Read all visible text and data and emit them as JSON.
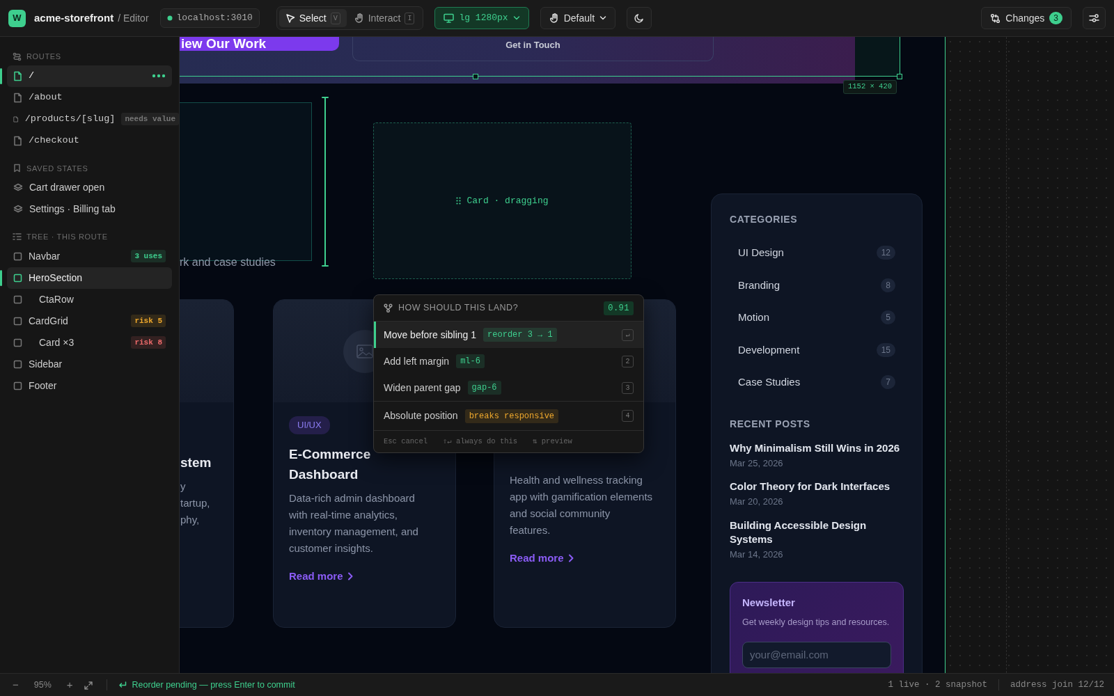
{
  "topbar": {
    "logo": "W",
    "project": "acme-storefront",
    "section": "/ Editor",
    "server": "localhost:3010",
    "modes": [
      {
        "label": "Select",
        "key": "V",
        "selected": true
      },
      {
        "label": "Interact",
        "key": "I",
        "selected": false
      }
    ],
    "breakpoint": "lg 1280px",
    "pointer": "Default",
    "changes": {
      "label": "Changes",
      "count": "3"
    }
  },
  "sidebar": [
    {
      "title": "ROUTES",
      "kind": "routes",
      "items": [
        {
          "label": "/",
          "selected": true
        },
        {
          "label": "/about",
          "selected": false
        },
        {
          "label": "/products/[slug]",
          "selected": false,
          "badge": "needs value",
          "color": "#777777"
        },
        {
          "label": "/checkout",
          "selected": false
        }
      ]
    },
    {
      "title": "SAVED STATES",
      "kind": "states",
      "items": [
        {
          "label": "Cart drawer open",
          "selected": false
        },
        {
          "label": "Settings · Billing tab",
          "selected": false
        }
      ]
    },
    {
      "title": "TREE · THIS ROUTE",
      "kind": "tree",
      "items": [
        {
          "label": "Navbar",
          "selected": false,
          "badge": "3 uses",
          "color": "#3ecf8e"
        },
        {
          "label": "HeroSection",
          "selected": true,
          "children": [
            {
              "label": "CtaRow",
              "selected": false
            }
          ]
        },
        {
          "label": "CardGrid",
          "selected": false,
          "badge": "risk 5",
          "color": "#f0a92c",
          "children": [
            {
              "label": "Card ×3",
              "selected": false,
              "badge": "risk 8",
              "color": "#f06b6b"
            }
          ]
        },
        {
          "label": "Sidebar",
          "selected": false
        },
        {
          "label": "Footer",
          "selected": false
        }
      ]
    }
  ],
  "preview": {
    "hero": {
      "primary": "iew Our Work",
      "secondary": "Get in Touch"
    },
    "dimensions": "1152 × 420",
    "fragment": "rk and case studies",
    "ghost": "Card · dragging",
    "cards": [
      {
        "title": "stem",
        "lines": [
          "y",
          "tartup,",
          "phy,"
        ]
      },
      {
        "image": true,
        "tag": "UI/UX",
        "title": "E-Commerce Dashboard",
        "desc": "Data-rich admin dashboard with real-time analytics, inventory management, and customer insights.",
        "link": "Read more"
      },
      {
        "desc": "Health and wellness tracking app with gamification elements and social community features.",
        "link": "Read more"
      }
    ],
    "categories": {
      "title": "CATEGORIES",
      "items": [
        {
          "label": "UI Design",
          "count": "12"
        },
        {
          "label": "Branding",
          "count": "8"
        },
        {
          "label": "Motion",
          "count": "5"
        },
        {
          "label": "Development",
          "count": "15"
        },
        {
          "label": "Case Studies",
          "count": "7"
        }
      ]
    },
    "recent": {
      "title": "RECENT POSTS",
      "items": [
        {
          "title": "Why Minimalism Still Wins in 2026",
          "date": "Mar 25, 2026"
        },
        {
          "title": "Color Theory for Dark Interfaces",
          "date": "Mar 20, 2026"
        },
        {
          "title": "Building Accessible Design Systems",
          "date": "Mar 14, 2026"
        }
      ]
    },
    "newsletter": {
      "title": "Newsletter",
      "text": "Get weekly design tips and resources.",
      "placeholder": "your@email.com"
    }
  },
  "popover": {
    "title": "HOW SHOULD THIS LAND?",
    "score": "0.91",
    "options": [
      {
        "label": "Move before sibling 1",
        "tag": "reorder 3 → 1",
        "color": "#3ecf8e",
        "key": "↵",
        "selected": true
      },
      {
        "label": "Add left margin",
        "tag": "ml-6",
        "color": "#3ecf8e",
        "key": "2",
        "selected": false
      },
      {
        "label": "Widen parent gap",
        "tag": "gap-6",
        "color": "#3ecf8e",
        "key": "3",
        "selected": false
      },
      {
        "label": "Absolute position",
        "tag": "breaks responsive",
        "color": "#f0a92c",
        "key": "4",
        "selected": false,
        "separated": true
      }
    ],
    "hints": [
      "Esc cancel",
      "⇧↵ always do this",
      "⇅ preview"
    ]
  },
  "status": {
    "zoom_out": "−",
    "zoom": "95%",
    "zoom_in": "+",
    "message": "Reorder pending — press Enter to commit",
    "sessions": "1 live · 2 snapshot",
    "address": "address join 12/12"
  }
}
